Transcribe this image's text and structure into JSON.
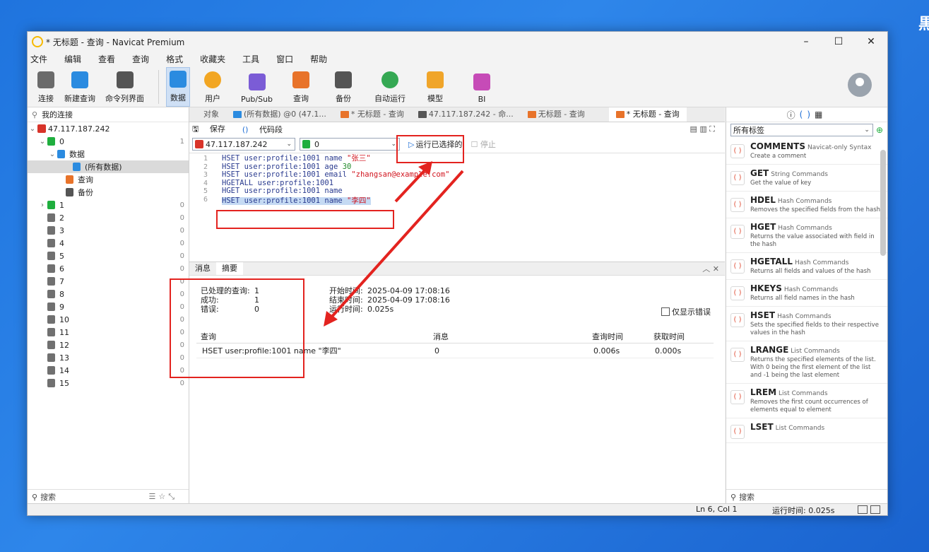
{
  "window": {
    "title": "* 无标题 - 查询 - Navicat Premium"
  },
  "desktop": {
    "glyph": "黒"
  },
  "menu": [
    "文件",
    "编辑",
    "查看",
    "查询",
    "格式",
    "收藏夹",
    "工具",
    "窗口",
    "帮助"
  ],
  "toolbar": {
    "items": [
      {
        "label": "连接",
        "icon": "connect-icon",
        "color": "#6b6b6b"
      },
      {
        "label": "新建查询",
        "icon": "new-query-icon",
        "color": "#2b8be0"
      },
      {
        "label": "命令列界面",
        "icon": "console-icon",
        "color": "#555555"
      },
      {
        "label": "数据",
        "icon": "data-icon",
        "color": "#2b8be0"
      },
      {
        "label": "用户",
        "icon": "user-icon",
        "color": "#f2a623"
      },
      {
        "label": "Pub/Sub",
        "icon": "pubsub-icon",
        "color": "#7b5cd6"
      },
      {
        "label": "查询",
        "icon": "query-icon",
        "color": "#e8732a"
      },
      {
        "label": "备份",
        "icon": "backup-icon",
        "color": "#555555"
      },
      {
        "label": "自动运行",
        "icon": "robot-icon",
        "color": "#35a853"
      },
      {
        "label": "模型",
        "icon": "model-icon",
        "color": "#f0a52a"
      },
      {
        "label": "BI",
        "icon": "bi-icon",
        "color": "#c64bb7"
      }
    ]
  },
  "left": {
    "header": "我的连接",
    "connection": "47.117.187.242",
    "db0": {
      "label": "0",
      "count": "1"
    },
    "data_label": "数据",
    "all_data": "(所有数据)",
    "query": "查询",
    "backup": "备份",
    "dbs": [
      {
        "label": "1",
        "count": "0"
      },
      {
        "label": "2",
        "count": "0"
      },
      {
        "label": "3",
        "count": "0"
      },
      {
        "label": "4",
        "count": "0"
      },
      {
        "label": "5",
        "count": "0"
      },
      {
        "label": "6",
        "count": "0"
      },
      {
        "label": "7",
        "count": "0"
      },
      {
        "label": "8",
        "count": "0"
      },
      {
        "label": "9",
        "count": "0"
      },
      {
        "label": "10",
        "count": "0"
      },
      {
        "label": "11",
        "count": "0"
      },
      {
        "label": "12",
        "count": "0"
      },
      {
        "label": "13",
        "count": "0"
      },
      {
        "label": "14",
        "count": "0"
      },
      {
        "label": "15",
        "count": "0"
      }
    ],
    "search": "搜索"
  },
  "tabs": [
    {
      "label": "对象"
    },
    {
      "label": "(所有数据) @0 (47.1..."
    },
    {
      "label": "* 无标题 - 查询"
    },
    {
      "label": "47.117.187.242 - 命..."
    },
    {
      "label": "无标题 - 查询"
    },
    {
      "label": "* 无标题 - 查询"
    }
  ],
  "qtools": {
    "save": "保存",
    "snippet": "代码段"
  },
  "qsel": {
    "conn": "47.117.187.242",
    "db": "0",
    "run": "运行已选择的",
    "stop": "停止"
  },
  "editor": {
    "line_numbers": [
      "1",
      "2",
      "3",
      "4",
      "5",
      "6"
    ],
    "lines": [
      {
        "cmd": "HSET user:profile:1001 name ",
        "val": "\"张三\""
      },
      {
        "cmd": "HSET user:profile:1001 age ",
        "val": "30"
      },
      {
        "cmd": "HSET user:profile:1001 email ",
        "val": "\"zhangsan@example.com\""
      },
      {
        "cmd": "HGETALL user:profile:1001",
        "val": ""
      },
      {
        "cmd": "HGET user:profile:1001 name",
        "val": ""
      },
      {
        "cmd": "HSET user:profile:1001 name ",
        "val": "\"李四\""
      }
    ]
  },
  "results": {
    "tabs": [
      "消息",
      "摘要"
    ],
    "summary": [
      {
        "k": "已处理的查询:",
        "v": "1"
      },
      {
        "k": "成功:",
        "v": "1"
      },
      {
        "k": "错误:",
        "v": "0"
      }
    ],
    "times": [
      {
        "k": "开始时间:",
        "v": "2025-04-09 17:08:16"
      },
      {
        "k": "结束时间:",
        "v": "2025-04-09 17:08:16"
      },
      {
        "k": "运行时间:",
        "v": "0.025s"
      }
    ],
    "only_errors": "仅显示错误",
    "columns": [
      "查询",
      "消息",
      "查询时间",
      "获取时间"
    ],
    "rows": [
      {
        "query": "HSET user:profile:1001 name \"李四\"",
        "msg": "0",
        "qtime": "0.006s",
        "ftime": "0.000s"
      }
    ]
  },
  "right": {
    "filter": "所有标签",
    "snippets": [
      {
        "name": "COMMENTS",
        "cat": "Navicat-only Syntax",
        "desc": "Create a comment"
      },
      {
        "name": "GET",
        "cat": "String Commands",
        "desc": "Get the value of key"
      },
      {
        "name": "HDEL",
        "cat": "Hash Commands",
        "desc": "Removes the specified fields from the hash"
      },
      {
        "name": "HGET",
        "cat": "Hash Commands",
        "desc": "Returns the value associated with field in the hash"
      },
      {
        "name": "HGETALL",
        "cat": "Hash Commands",
        "desc": "Returns all fields and values of the hash"
      },
      {
        "name": "HKEYS",
        "cat": "Hash Commands",
        "desc": "Returns all field names in the hash"
      },
      {
        "name": "HSET",
        "cat": "Hash Commands",
        "desc": "Sets the specified fields to their respective values in the hash"
      },
      {
        "name": "LRANGE",
        "cat": "List Commands",
        "desc": "Returns the specified elements of the list. With 0 being the first element of the list and -1 being the last element"
      },
      {
        "name": "LREM",
        "cat": "List Commands",
        "desc": "Removes the first count occurrences of elements equal to element"
      },
      {
        "name": "LSET",
        "cat": "List Commands",
        "desc": ""
      }
    ],
    "search": "搜索"
  },
  "status": {
    "pos": "Ln 6, Col 1",
    "runtime": "运行时间: 0.025s"
  },
  "annotation_color": "#e3231f"
}
